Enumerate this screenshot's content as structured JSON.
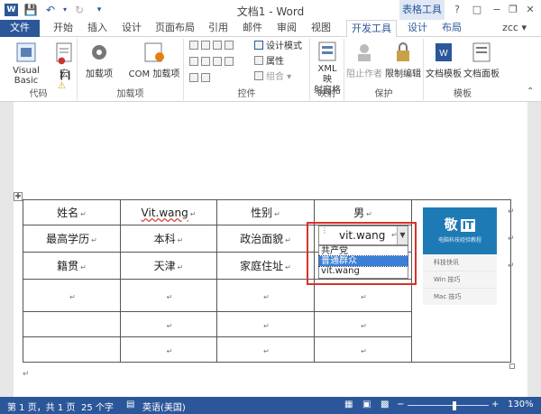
{
  "title_bar": {
    "title": "文档1 - Word",
    "context_tab_group": "表格工具",
    "help": "?",
    "minimize": "−",
    "restore": "❐",
    "close": "✕"
  },
  "tabs": {
    "file": "文件",
    "items": [
      "开始",
      "插入",
      "设计",
      "页面布局",
      "引用",
      "邮件",
      "审阅",
      "视图",
      "开发工具"
    ],
    "context_items": [
      "设计",
      "布局"
    ],
    "user": "zcc"
  },
  "ribbon": {
    "code": {
      "label": "代码",
      "visual_basic": "Visual Basic",
      "macro": "宏"
    },
    "addins": {
      "label": "加载项",
      "addins": "加载项",
      "com_addins": "COM 加载项"
    },
    "controls": {
      "label": "控件",
      "design_mode": "设计模式",
      "properties": "属性",
      "group": "组合"
    },
    "mapping": {
      "label": "映射",
      "xml_pane_line1": "XML 映",
      "xml_pane_line2": "射窗格"
    },
    "protect": {
      "label": "保护",
      "block_authors": "阻止作者",
      "restrict_editing": "限制编辑"
    },
    "templates": {
      "label": "模板",
      "doc_template": "文档模板",
      "doc_panel": "文档面板"
    }
  },
  "table": {
    "row1": [
      "姓名",
      "Vit.wang",
      "性别",
      "男"
    ],
    "row2": [
      "最高学历",
      "本科",
      "政治面貌"
    ],
    "row3": [
      "籍贯",
      "天津",
      "家庭住址"
    ],
    "para_mark": "↵"
  },
  "dropdown": {
    "value": "vit.wang",
    "options": [
      "共产党",
      "普通群众",
      "vit.wang"
    ],
    "selected_index": 1
  },
  "logo": {
    "title": "敬",
    "badge": "IT",
    "subtitle": "电脑科技经验教程",
    "menu": [
      "科技快讯",
      "Win 技巧",
      "Mac 技巧"
    ]
  },
  "status_bar": {
    "page": "第 1 页，共 1 页",
    "words": "25 个字",
    "language": "英语(美国)",
    "zoom": "130%"
  },
  "colors": {
    "brand": "#2b579a",
    "highlight_box": "#d9312b",
    "selected_option": "#3c7fd6",
    "logo": "#1e7ab5"
  }
}
